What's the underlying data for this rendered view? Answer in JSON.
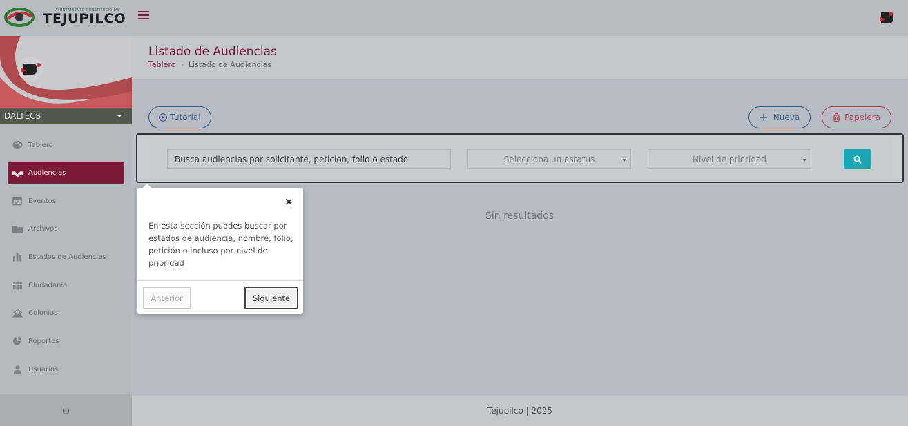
{
  "topbar": {
    "brand_small": "AYUNTAMIENTO CONSTITUCIONAL",
    "brand": "TEJUPILCO",
    "logo_icon": "tejupilco-logo-icon",
    "menu_icon": "hamburger-icon",
    "avatar_icon": "user-avatar-icon"
  },
  "sidebar": {
    "user_name": "DALTECS",
    "items": [
      {
        "label": "Tablero",
        "icon": "palette-dashboard-icon"
      },
      {
        "label": "Audiencias",
        "icon": "handshake-icon",
        "active": true
      },
      {
        "label": "Eventos",
        "icon": "calendar-icon"
      },
      {
        "label": "Archivos",
        "icon": "folder-icon"
      },
      {
        "label": "Estados de Audiencias",
        "icon": "bar-chart-icon"
      },
      {
        "label": "Ciudadania",
        "icon": "users-group-icon"
      },
      {
        "label": "Colonias",
        "icon": "landscape-icon"
      },
      {
        "label": "Reportes",
        "icon": "pie-chart-icon"
      },
      {
        "label": "Usuarios",
        "icon": "user-icon"
      }
    ],
    "footer_icon": "power-icon"
  },
  "header": {
    "title": "Listado de Audiencias",
    "breadcrumb_home": "Tablero",
    "breadcrumb_current": "Listado de Audiencias"
  },
  "actions": {
    "tutorial": "Tutorial",
    "nueva": "Nueva",
    "papelera": "Papelera"
  },
  "search": {
    "input_value": "Busca audiencias por solicitante, peticion, folio o estado",
    "status_placeholder": "Selecciona un estatus",
    "priority_placeholder": "Nivel de prioridad"
  },
  "results": {
    "empty": "Sin resultados"
  },
  "tour": {
    "text": "En esta sección puedes buscar por estados de audiencia, nombre, folio, petición o incluso por nivel de prioridad",
    "close": "×",
    "prev": "Anterior",
    "next": "Siguiente"
  },
  "footer": {
    "text": "Tejupilco | 2025"
  },
  "colors": {
    "primary": "#7a1a36",
    "accent": "#1aa7b8",
    "outline_blue": "#3a5f86",
    "outline_red": "#a8475c"
  }
}
